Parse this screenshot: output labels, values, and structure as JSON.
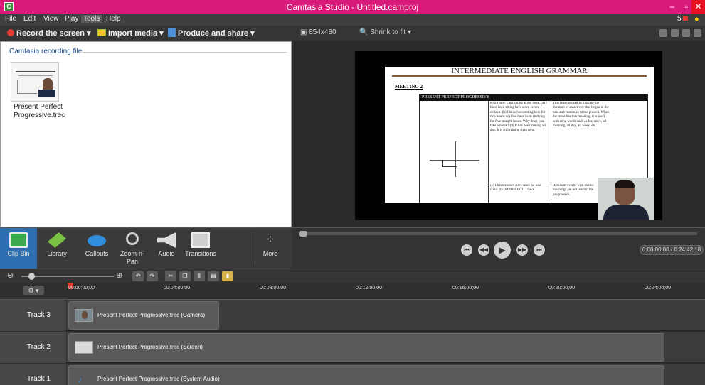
{
  "window": {
    "app_icon": "C",
    "title": "Camtasia Studio - Untitled.camproj",
    "minimize_icon": "minimize-icon",
    "maximize_icon": "maximize-icon",
    "close_icon": "close-icon"
  },
  "menu": {
    "items": [
      "File",
      "Edit",
      "View",
      "Play",
      "Tools",
      "Help"
    ],
    "active": "Tools",
    "notification_count": "5"
  },
  "toolbar": {
    "record_label": "Record the screen ▾",
    "import_label": "Import media ▾",
    "produce_label": "Produce and share ▾"
  },
  "clip_bin": {
    "section_title": "Camtasia recording file",
    "clip_name": "Present Perfect Progressive.trec"
  },
  "preview": {
    "resolution": "854x480",
    "zoom_label": "Shrink to fit ▾",
    "doc_title": "INTERMEDIATE ENGLISH GRAMMAR",
    "doc_meeting": "MEETING 2",
    "doc_table_header": "PRESENT PERFECT PROGRESSIVE",
    "doc_examples": "Right now, I am sitting at my desk. (a) I have been sitting here since seven o'clock. (b) I have been sitting here for two hours. (c) You have been studying for five straight hours. Why don't you take a break? (d) It has been raining all day. It is still raining right now.",
    "doc_examples2": "(e) I have known Alex since he was child. (f) INCORRECT: I have",
    "doc_explain": "This tense is used to indicate the duration of an activity that began in the past and continues to the present. When the tense has this meaning, it is used with time words such as for, since, all morning, all day, all week, etc.",
    "doc_reminder": "Reminder: verbs with stative meanings are not used in the progressive."
  },
  "playback": {
    "time": "0:00:00;00 / 0:24:42;18"
  },
  "tasks": [
    {
      "label": "Clip Bin",
      "icon": "clip-bin-icon"
    },
    {
      "label": "Library",
      "icon": "library-icon"
    },
    {
      "label": "Callouts",
      "icon": "callouts-icon"
    },
    {
      "label": "Zoom-n-Pan",
      "icon": "zoom-n-pan-icon"
    },
    {
      "label": "Audio",
      "icon": "audio-icon"
    },
    {
      "label": "Transitions",
      "icon": "transitions-icon"
    },
    {
      "label": "More",
      "icon": "more-icon"
    }
  ],
  "timeline": {
    "ruler": [
      "00:00:00;00",
      "00:04:00;00",
      "00:08:00;00",
      "00:12:00;00",
      "00:16:00;00",
      "00:20:00;00",
      "00:24:00;00"
    ],
    "tracks": [
      {
        "label": "Track 3",
        "clip": "Present Perfect Progressive.trec (Camera)"
      },
      {
        "label": "Track 2",
        "clip": "Present Perfect Progressive.trec (Screen)"
      },
      {
        "label": "Track 1",
        "clip": "Present Perfect Progressive.trec (System Audio)"
      }
    ]
  }
}
